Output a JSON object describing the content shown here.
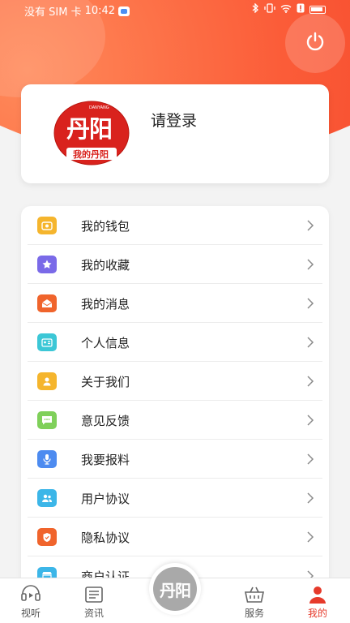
{
  "status_bar": {
    "carrier": "没有 SIM 卡",
    "time": "10:42"
  },
  "header": {
    "power_icon": "power-icon",
    "brand_color": "#f0351f"
  },
  "profile": {
    "login_prompt": "请登录",
    "logo": {
      "mark": "丹阳",
      "subtitle": "DANYANG",
      "caption": "我的丹阳"
    }
  },
  "menu": {
    "items": [
      {
        "label": "我的钱包",
        "icon": "wallet-icon",
        "color": "#f5b52d"
      },
      {
        "label": "我的收藏",
        "icon": "star-icon",
        "color": "#7a6ae8"
      },
      {
        "label": "我的消息",
        "icon": "message-icon",
        "color": "#f0642c"
      },
      {
        "label": "个人信息",
        "icon": "id-card-icon",
        "color": "#3cc7d6"
      },
      {
        "label": "关于我们",
        "icon": "person-icon",
        "color": "#f5b52d"
      },
      {
        "label": "意见反馈",
        "icon": "feedback-icon",
        "color": "#7fd05a"
      },
      {
        "label": "我要报料",
        "icon": "microphone-icon",
        "color": "#4d8bf0"
      },
      {
        "label": "用户协议",
        "icon": "users-icon",
        "color": "#3cb6e8"
      },
      {
        "label": "隐私协议",
        "icon": "shield-icon",
        "color": "#f0642c"
      },
      {
        "label": "商户认证",
        "icon": "shop-icon",
        "color": "#3cb6e8"
      }
    ]
  },
  "tabbar": {
    "tabs": [
      {
        "label": "视听",
        "icon": "audio-video-icon"
      },
      {
        "label": "资讯",
        "icon": "news-icon"
      },
      {
        "label": "服务",
        "icon": "basket-icon"
      },
      {
        "label": "我的",
        "icon": "person-icon",
        "active": true
      }
    ],
    "center_logo": "丹阳",
    "active_color": "#e63a2b"
  }
}
